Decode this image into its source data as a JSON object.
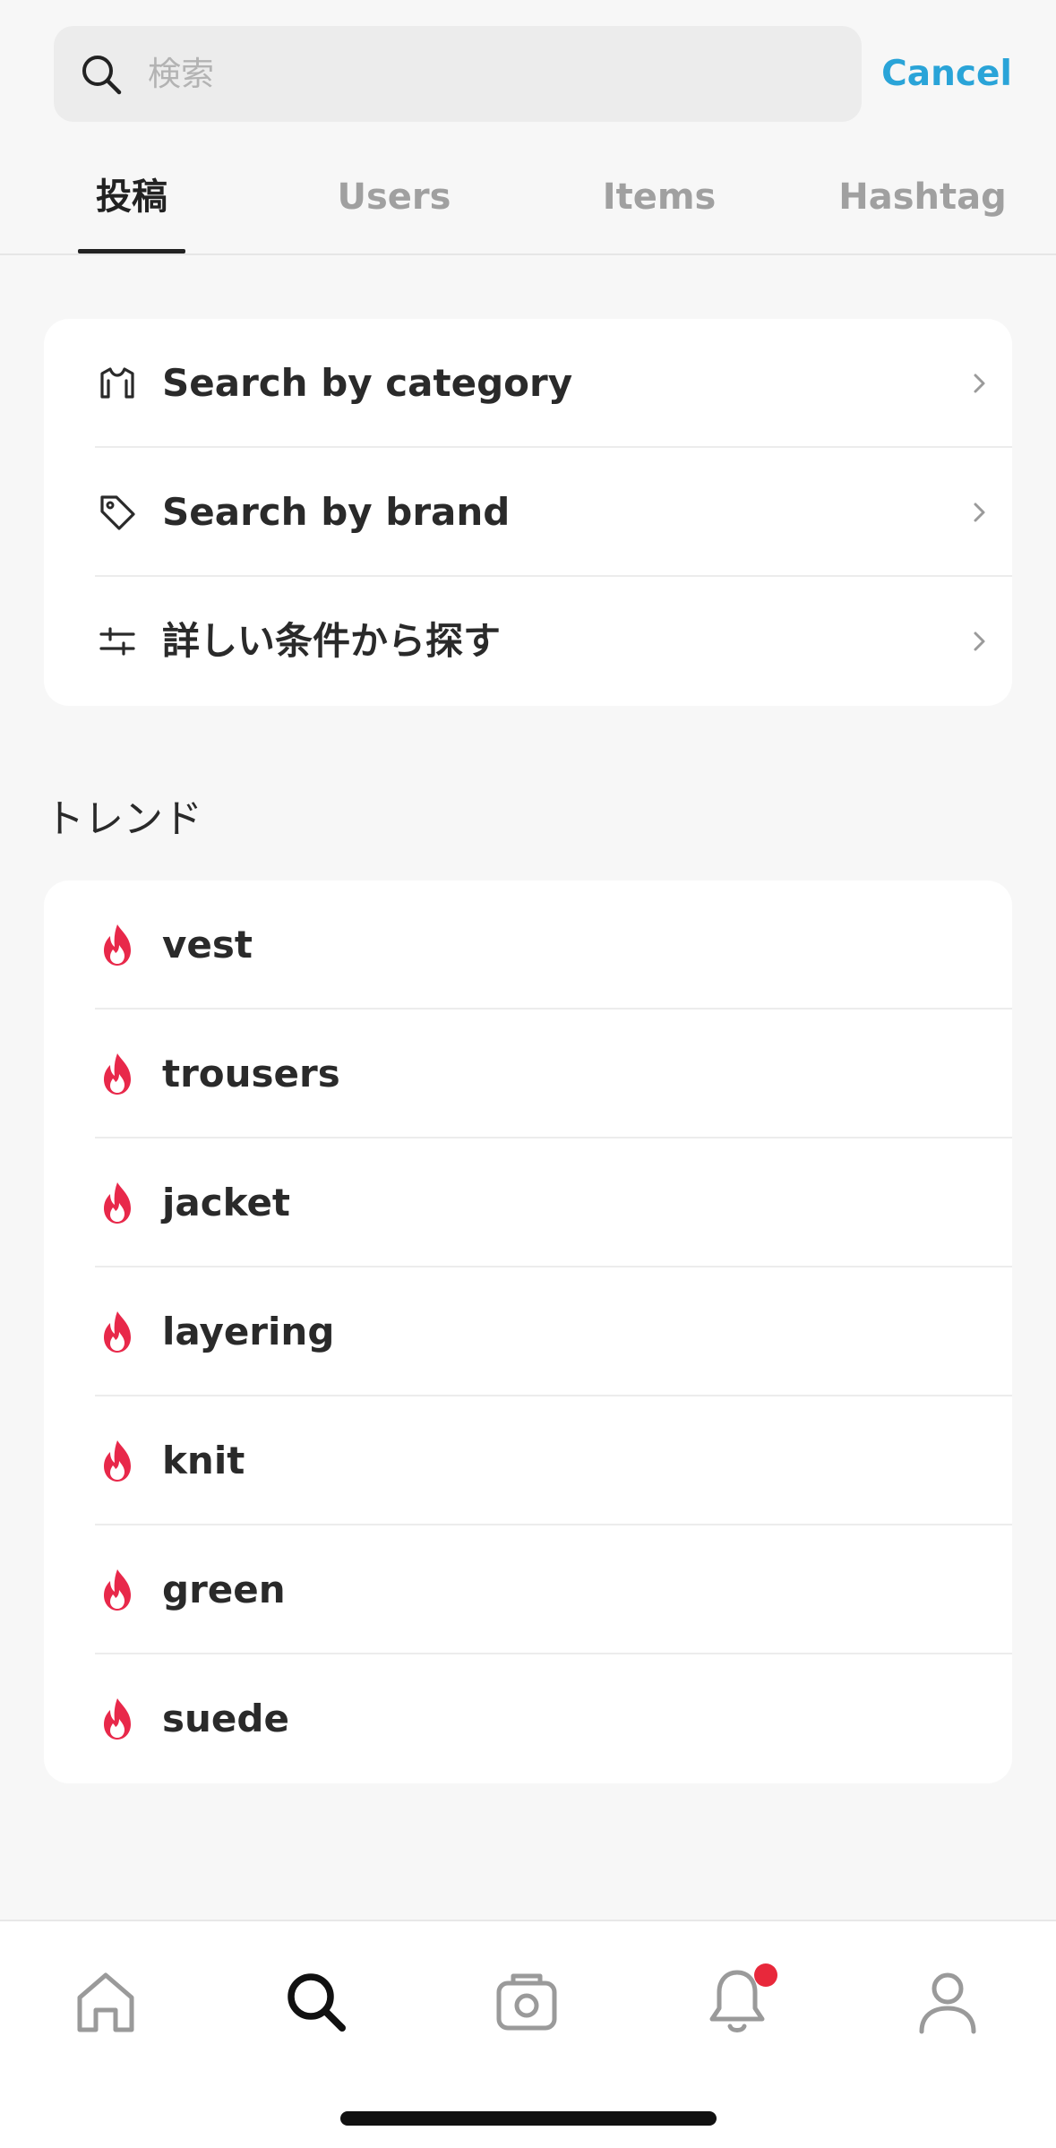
{
  "search": {
    "placeholder": "検索",
    "value": "",
    "cancel_label": "Cancel"
  },
  "tabs": [
    {
      "label": "投稿",
      "active": true
    },
    {
      "label": "Users",
      "active": false
    },
    {
      "label": "Items",
      "active": false
    },
    {
      "label": "Hashtag",
      "active": false
    }
  ],
  "search_options": [
    {
      "label": "Search by category",
      "icon": "shirt-icon"
    },
    {
      "label": "Search by brand",
      "icon": "tag-icon"
    },
    {
      "label": "詳しい条件から探す",
      "icon": "sliders-icon"
    }
  ],
  "trends": {
    "title": "トレンド",
    "icon": "flame-icon",
    "items": [
      "vest",
      "trousers",
      "jacket",
      "layering",
      "knit",
      "green",
      "suede"
    ]
  },
  "bottom_nav": [
    {
      "icon": "home-icon",
      "active": false
    },
    {
      "icon": "search-icon",
      "active": true
    },
    {
      "icon": "camera-icon",
      "active": false
    },
    {
      "icon": "bell-icon",
      "active": false,
      "badge": true
    },
    {
      "icon": "user-icon",
      "active": false
    }
  ],
  "colors": {
    "accent": "#2aa4d8",
    "flame": "#e8284a",
    "badge": "#e8283b",
    "background": "#f7f7f7"
  }
}
